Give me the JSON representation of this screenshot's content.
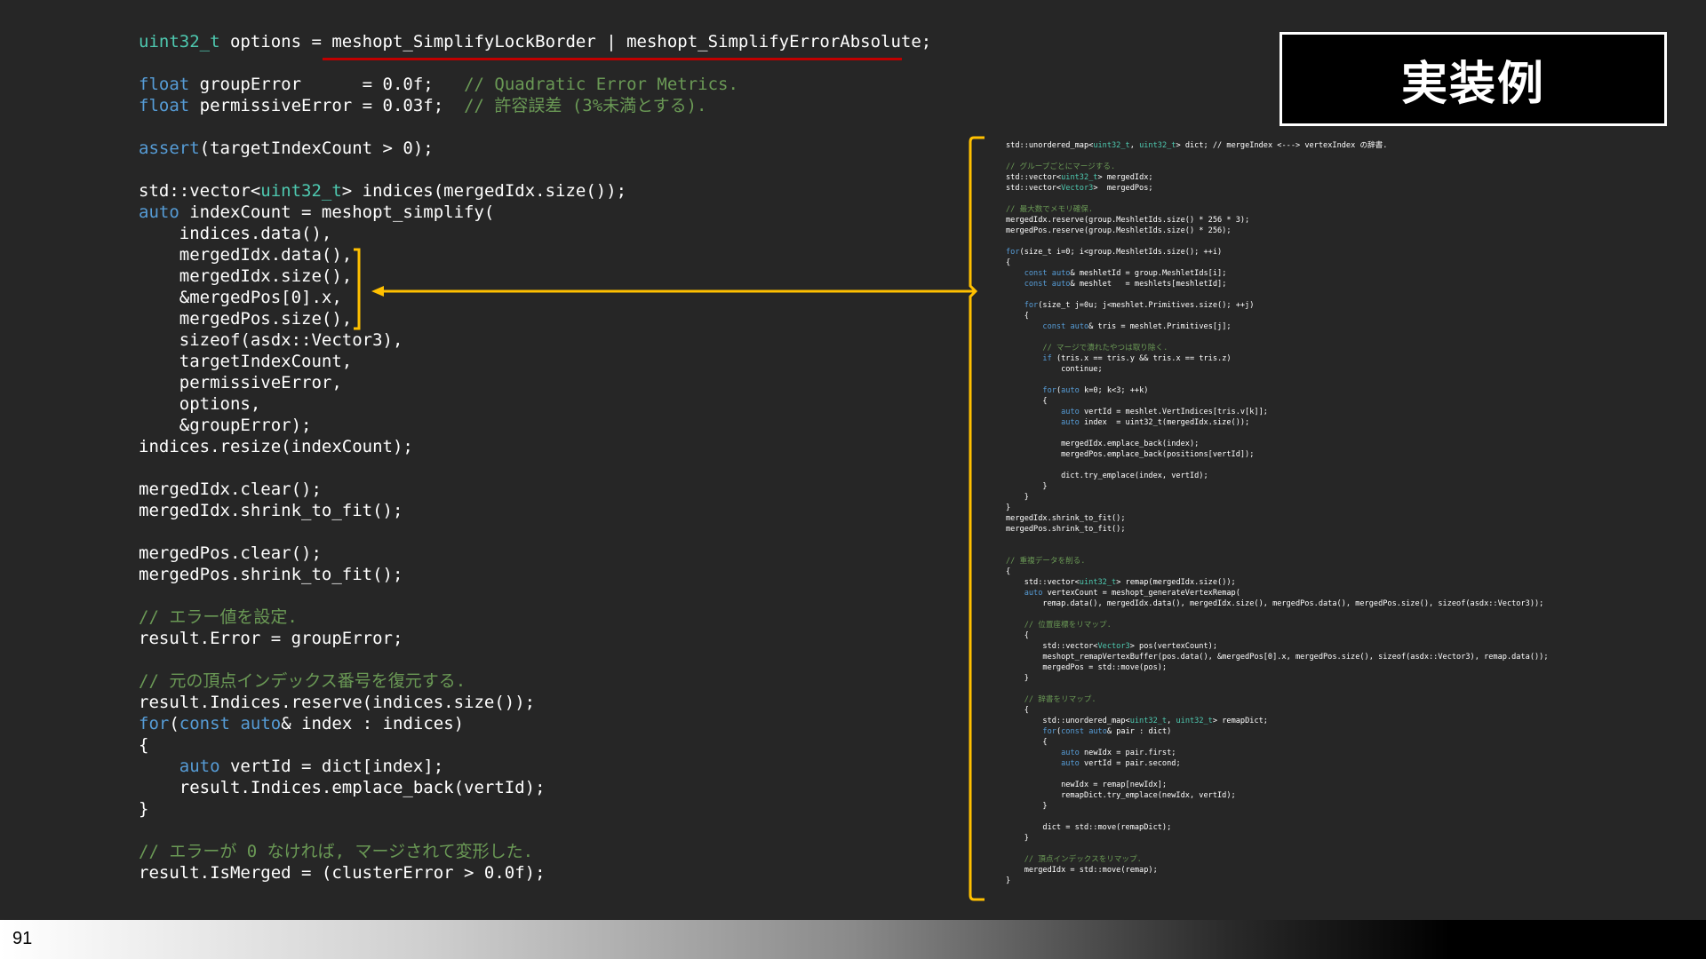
{
  "title": "実装例",
  "page_number": "91",
  "colors": {
    "background": "#262626",
    "type": "#4ec9b0",
    "keyword": "#569cd6",
    "comment": "#6a9955",
    "bracket": "#ffc000",
    "underline": "#c00000"
  },
  "main_code": [
    [
      [
        "type",
        "uint32_t"
      ],
      [
        "txt",
        " options = meshopt_SimplifyLockBorder | meshopt_SimplifyErrorAbsolute;"
      ]
    ],
    [],
    [
      [
        "kw",
        "float"
      ],
      [
        "txt",
        " groupError      = 0.0f;   "
      ],
      [
        "cmt",
        "// Quadratic Error Metrics."
      ]
    ],
    [
      [
        "kw",
        "float"
      ],
      [
        "txt",
        " permissiveError = 0.03f;  "
      ],
      [
        "cmt",
        "// 許容誤差 (3%未満とする)."
      ]
    ],
    [],
    [
      [
        "kw",
        "assert"
      ],
      [
        "txt",
        "(targetIndexCount > 0);"
      ]
    ],
    [],
    [
      [
        "txt",
        "std::vector<"
      ],
      [
        "type",
        "uint32_t"
      ],
      [
        "txt",
        "> indices(mergedIdx.size());"
      ]
    ],
    [
      [
        "kw",
        "auto"
      ],
      [
        "txt",
        " indexCount = meshopt_simplify("
      ]
    ],
    [
      [
        "txt",
        "    indices.data(),"
      ]
    ],
    [
      [
        "txt",
        "    mergedIdx.data(),"
      ]
    ],
    [
      [
        "txt",
        "    mergedIdx.size(),"
      ]
    ],
    [
      [
        "txt",
        "    &mergedPos[0].x,"
      ]
    ],
    [
      [
        "txt",
        "    mergedPos.size(),"
      ]
    ],
    [
      [
        "txt",
        "    sizeof(asdx::Vector3),"
      ]
    ],
    [
      [
        "txt",
        "    targetIndexCount,"
      ]
    ],
    [
      [
        "txt",
        "    permissiveError,"
      ]
    ],
    [
      [
        "txt",
        "    options,"
      ]
    ],
    [
      [
        "txt",
        "    &groupError);"
      ]
    ],
    [
      [
        "txt",
        "indices.resize(indexCount);"
      ]
    ],
    [],
    [
      [
        "txt",
        "mergedIdx.clear();"
      ]
    ],
    [
      [
        "txt",
        "mergedIdx.shrink_to_fit();"
      ]
    ],
    [],
    [
      [
        "txt",
        "mergedPos.clear();"
      ]
    ],
    [
      [
        "txt",
        "mergedPos.shrink_to_fit();"
      ]
    ],
    [],
    [
      [
        "cmt",
        "// エラー値を設定."
      ]
    ],
    [
      [
        "txt",
        "result.Error = groupError;"
      ]
    ],
    [],
    [
      [
        "cmt",
        "// 元の頂点インデックス番号を復元する."
      ]
    ],
    [
      [
        "txt",
        "result.Indices.reserve(indices.size());"
      ]
    ],
    [
      [
        "kw",
        "for"
      ],
      [
        "txt",
        "("
      ],
      [
        "kw",
        "const"
      ],
      [
        "txt",
        " "
      ],
      [
        "kw",
        "auto"
      ],
      [
        "txt",
        "& index : indices)"
      ]
    ],
    [
      [
        "txt",
        "{"
      ]
    ],
    [
      [
        "txt",
        "    "
      ],
      [
        "kw",
        "auto"
      ],
      [
        "txt",
        " vertId = dict[index];"
      ]
    ],
    [
      [
        "txt",
        "    result.Indices.emplace_back(vertId);"
      ]
    ],
    [
      [
        "txt",
        "}"
      ]
    ],
    [],
    [
      [
        "cmt",
        "// エラーが 0 なければ, マージされて変形した."
      ]
    ],
    [
      [
        "txt",
        "result.IsMerged = (clusterError > 0.0f);"
      ]
    ]
  ],
  "side_code": [
    [
      [
        "txt",
        "std::unordered_map<"
      ],
      [
        "type",
        "uint32_t"
      ],
      [
        "txt",
        ", "
      ],
      [
        "type",
        "uint32_t"
      ],
      [
        "txt",
        "> dict; // mergeIndex <---> vertexIndex の辞書."
      ]
    ],
    [],
    [
      [
        "cmt",
        "// グループごとにマージする."
      ]
    ],
    [
      [
        "txt",
        "std::vector<"
      ],
      [
        "type",
        "uint32_t"
      ],
      [
        "txt",
        "> mergedIdx;"
      ]
    ],
    [
      [
        "txt",
        "std::vector<"
      ],
      [
        "type",
        "Vector3"
      ],
      [
        "txt",
        ">  mergedPos;"
      ]
    ],
    [],
    [
      [
        "cmt",
        "// 最大数でメモリ確保."
      ]
    ],
    [
      [
        "txt",
        "mergedIdx.reserve(group.MeshletIds.size() * 256 * 3);"
      ]
    ],
    [
      [
        "txt",
        "mergedPos.reserve(group.MeshletIds.size() * 256);"
      ]
    ],
    [],
    [
      [
        "kw",
        "for"
      ],
      [
        "txt",
        "(size_t i=0; i<group.MeshletIds.size(); ++i)"
      ]
    ],
    [
      [
        "txt",
        "{"
      ]
    ],
    [
      [
        "txt",
        "    "
      ],
      [
        "kw",
        "const"
      ],
      [
        "txt",
        " "
      ],
      [
        "kw",
        "auto"
      ],
      [
        "txt",
        "& meshletId = group.MeshletIds[i];"
      ]
    ],
    [
      [
        "txt",
        "    "
      ],
      [
        "kw",
        "const"
      ],
      [
        "txt",
        " "
      ],
      [
        "kw",
        "auto"
      ],
      [
        "txt",
        "& meshlet   = meshlets[meshletId];"
      ]
    ],
    [],
    [
      [
        "txt",
        "    "
      ],
      [
        "kw",
        "for"
      ],
      [
        "txt",
        "(size_t j=0u; j<meshlet.Primitives.size(); ++j)"
      ]
    ],
    [
      [
        "txt",
        "    {"
      ]
    ],
    [
      [
        "txt",
        "        "
      ],
      [
        "kw",
        "const"
      ],
      [
        "txt",
        " "
      ],
      [
        "kw",
        "auto"
      ],
      [
        "txt",
        "& tris = meshlet.Primitives[j];"
      ]
    ],
    [],
    [
      [
        "txt",
        "        "
      ],
      [
        "cmt",
        "// マージで潰れたやつは取り除く."
      ]
    ],
    [
      [
        "txt",
        "        "
      ],
      [
        "kw",
        "if"
      ],
      [
        "txt",
        " (tris.x == tris.y && tris.x == tris.z)"
      ]
    ],
    [
      [
        "txt",
        "            continue;"
      ]
    ],
    [],
    [
      [
        "txt",
        "        "
      ],
      [
        "kw",
        "for"
      ],
      [
        "txt",
        "("
      ],
      [
        "kw",
        "auto"
      ],
      [
        "txt",
        " k=0; k<3; ++k)"
      ]
    ],
    [
      [
        "txt",
        "        {"
      ]
    ],
    [
      [
        "txt",
        "            "
      ],
      [
        "kw",
        "auto"
      ],
      [
        "txt",
        " vertId = meshlet.VertIndices[tris.v[k]];"
      ]
    ],
    [
      [
        "txt",
        "            "
      ],
      [
        "kw",
        "auto"
      ],
      [
        "txt",
        " index  = uint32_t(mergedIdx.size());"
      ]
    ],
    [],
    [
      [
        "txt",
        "            mergedIdx.emplace_back(index);"
      ]
    ],
    [
      [
        "txt",
        "            mergedPos.emplace_back(positions[vertId]);"
      ]
    ],
    [],
    [
      [
        "txt",
        "            dict.try_emplace(index, vertId);"
      ]
    ],
    [
      [
        "txt",
        "        }"
      ]
    ],
    [
      [
        "txt",
        "    }"
      ]
    ],
    [
      [
        "txt",
        "}"
      ]
    ],
    [
      [
        "txt",
        "mergedIdx.shrink_to_fit();"
      ]
    ],
    [
      [
        "txt",
        "mergedPos.shrink_to_fit();"
      ]
    ],
    [],
    [],
    [
      [
        "cmt",
        "// 重複データを削る."
      ]
    ],
    [
      [
        "txt",
        "{"
      ]
    ],
    [
      [
        "txt",
        "    std::vector<"
      ],
      [
        "type",
        "uint32_t"
      ],
      [
        "txt",
        "> remap(mergedIdx.size());"
      ]
    ],
    [
      [
        "txt",
        "    "
      ],
      [
        "kw",
        "auto"
      ],
      [
        "txt",
        " vertexCount = meshopt_generateVertexRemap("
      ]
    ],
    [
      [
        "txt",
        "        remap.data(), mergedIdx.data(), mergedIdx.size(), mergedPos.data(), mergedPos.size(), sizeof(asdx::Vector3));"
      ]
    ],
    [],
    [
      [
        "txt",
        "    "
      ],
      [
        "cmt",
        "// 位置座標をリマップ."
      ]
    ],
    [
      [
        "txt",
        "    {"
      ]
    ],
    [
      [
        "txt",
        "        std::vector<"
      ],
      [
        "type",
        "Vector3"
      ],
      [
        "txt",
        "> pos(vertexCount);"
      ]
    ],
    [
      [
        "txt",
        "        meshopt_remapVertexBuffer(pos.data(), &mergedPos[0].x, mergedPos.size(), sizeof(asdx::Vector3), remap.data());"
      ]
    ],
    [
      [
        "txt",
        "        mergedPos = std::move(pos);"
      ]
    ],
    [
      [
        "txt",
        "    }"
      ]
    ],
    [],
    [
      [
        "txt",
        "    "
      ],
      [
        "cmt",
        "// 辞書をリマップ."
      ]
    ],
    [
      [
        "txt",
        "    {"
      ]
    ],
    [
      [
        "txt",
        "        std::unordered_map<"
      ],
      [
        "type",
        "uint32_t"
      ],
      [
        "txt",
        ", "
      ],
      [
        "type",
        "uint32_t"
      ],
      [
        "txt",
        "> remapDict;"
      ]
    ],
    [
      [
        "txt",
        "        "
      ],
      [
        "kw",
        "for"
      ],
      [
        "txt",
        "("
      ],
      [
        "kw",
        "const"
      ],
      [
        "txt",
        " "
      ],
      [
        "kw",
        "auto"
      ],
      [
        "txt",
        "& pair : dict)"
      ]
    ],
    [
      [
        "txt",
        "        {"
      ]
    ],
    [
      [
        "txt",
        "            "
      ],
      [
        "kw",
        "auto"
      ],
      [
        "txt",
        " newIdx = pair.first;"
      ]
    ],
    [
      [
        "txt",
        "            "
      ],
      [
        "kw",
        "auto"
      ],
      [
        "txt",
        " vertId = pair.second;"
      ]
    ],
    [],
    [
      [
        "txt",
        "            newIdx = remap[newIdx];"
      ]
    ],
    [
      [
        "txt",
        "            remapDict.try_emplace(newIdx, vertId);"
      ]
    ],
    [
      [
        "txt",
        "        }"
      ]
    ],
    [],
    [
      [
        "txt",
        "        dict = std::move(remapDict);"
      ]
    ],
    [
      [
        "txt",
        "    }"
      ]
    ],
    [],
    [
      [
        "txt",
        "    "
      ],
      [
        "cmt",
        "// 頂点インデックスをリマップ."
      ]
    ],
    [
      [
        "txt",
        "    mergedIdx = std::move(remap);"
      ]
    ],
    [
      [
        "txt",
        "}"
      ]
    ]
  ]
}
